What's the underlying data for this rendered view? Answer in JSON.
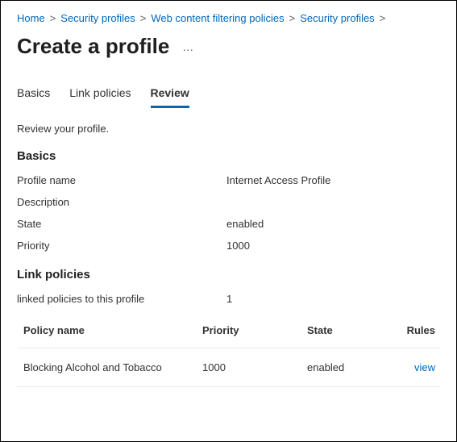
{
  "breadcrumb": {
    "items": [
      {
        "label": "Home"
      },
      {
        "label": "Security profiles"
      },
      {
        "label": "Web content filtering policies"
      },
      {
        "label": "Security profiles"
      }
    ],
    "separator": ">"
  },
  "header": {
    "title": "Create a profile",
    "more_icon": "…"
  },
  "tabs": {
    "items": [
      {
        "label": "Basics",
        "active": false
      },
      {
        "label": "Link policies",
        "active": false
      },
      {
        "label": "Review",
        "active": true
      }
    ]
  },
  "instruction": "Review your profile.",
  "sections": {
    "basics": {
      "title": "Basics",
      "fields": [
        {
          "label": "Profile name",
          "value": "Internet Access Profile"
        },
        {
          "label": "Description",
          "value": ""
        },
        {
          "label": "State",
          "value": "enabled"
        },
        {
          "label": "Priority",
          "value": "1000"
        }
      ]
    },
    "linkPolicies": {
      "title": "Link policies",
      "summaryLabel": "linked policies to this profile",
      "summaryValue": "1",
      "columns": {
        "name": "Policy name",
        "priority": "Priority",
        "state": "State",
        "rules": "Rules"
      },
      "rows": [
        {
          "name": "Blocking Alcohol and Tobacco",
          "priority": "1000",
          "state": "enabled",
          "rules": "view"
        }
      ]
    }
  }
}
